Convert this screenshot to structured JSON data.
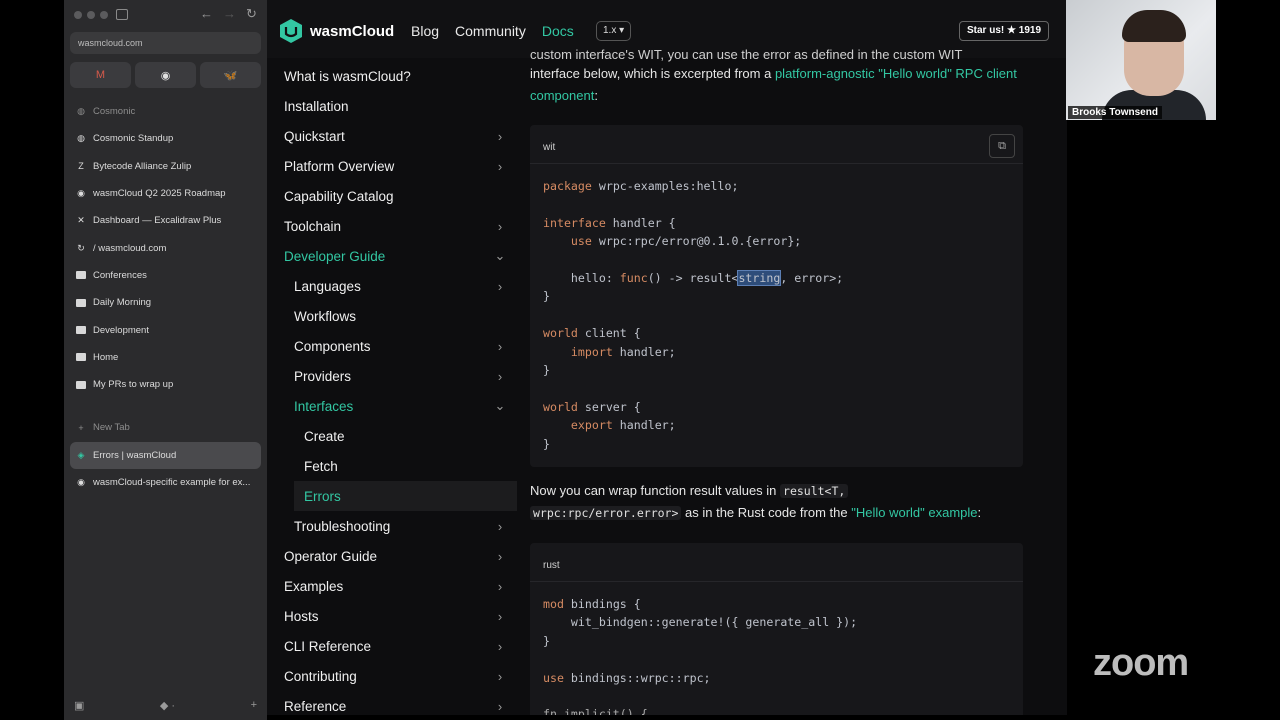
{
  "browser": {
    "url": "wasmcloud.com",
    "pinned": [
      {
        "icon": "gmail-icon",
        "glyph": "M",
        "color": "#d65a4b"
      },
      {
        "icon": "github-icon",
        "glyph": "◉",
        "color": "#e0e0e0"
      },
      {
        "icon": "bluesky-icon",
        "glyph": "🦋",
        "color": "#4a8bdc"
      }
    ],
    "bookmarks": [
      {
        "label": "Cosmonic",
        "icon": "cosmonic-icon",
        "glyph": "◍",
        "muted": true
      },
      {
        "label": "Cosmonic Standup",
        "icon": "cosmonic-icon",
        "glyph": "◍",
        "muted": false
      },
      {
        "label": "Bytecode Alliance Zulip",
        "icon": "zulip-icon",
        "glyph": "Z",
        "muted": false
      },
      {
        "label": "wasmCloud Q2 2025 Roadmap",
        "icon": "github-icon",
        "glyph": "◉",
        "muted": false
      },
      {
        "label": "Dashboard — Excalidraw Plus",
        "icon": "excalidraw-icon",
        "glyph": "✕",
        "muted": false
      },
      {
        "label": "/ wasmcloud.com",
        "icon": "refresh-icon",
        "glyph": "↻",
        "muted": false
      },
      {
        "label": "Conferences",
        "icon": "folder-icon",
        "glyph": "",
        "muted": false
      },
      {
        "label": "Daily Morning",
        "icon": "folder-icon",
        "glyph": "",
        "muted": false
      },
      {
        "label": "Development",
        "icon": "folder-icon",
        "glyph": "",
        "muted": false
      },
      {
        "label": "Home",
        "icon": "folder-icon",
        "glyph": "",
        "muted": false
      },
      {
        "label": "My PRs to wrap up",
        "icon": "folder-icon",
        "glyph": "",
        "muted": false
      }
    ],
    "new_tab": "New Tab",
    "tabs": [
      {
        "label": "Errors | wasmCloud",
        "active": true
      },
      {
        "label": "wasmCloud-specific example for ex...",
        "active": false
      }
    ]
  },
  "header": {
    "brand": "wasmCloud",
    "nav": [
      "Blog",
      "Community",
      "Docs"
    ],
    "version": "1.x ▾",
    "star": "Star us! ★ 1919"
  },
  "sidebar": {
    "items": [
      {
        "label": "What is wasmCloud?",
        "level": 0,
        "chevron": ""
      },
      {
        "label": "Installation",
        "level": 0,
        "chevron": ""
      },
      {
        "label": "Quickstart",
        "level": 0,
        "chevron": "›"
      },
      {
        "label": "Platform Overview",
        "level": 0,
        "chevron": "›"
      },
      {
        "label": "Capability Catalog",
        "level": 0,
        "chevron": ""
      },
      {
        "label": "Toolchain",
        "level": 0,
        "chevron": "›"
      },
      {
        "label": "Developer Guide",
        "level": 0,
        "chevron": "⌄",
        "green": true
      },
      {
        "label": "Languages",
        "level": 1,
        "chevron": "›"
      },
      {
        "label": "Workflows",
        "level": 1,
        "chevron": ""
      },
      {
        "label": "Components",
        "level": 1,
        "chevron": "›"
      },
      {
        "label": "Providers",
        "level": 1,
        "chevron": "›"
      },
      {
        "label": "Interfaces",
        "level": 1,
        "chevron": "⌄",
        "green": true
      },
      {
        "label": "Create",
        "level": 2,
        "chevron": ""
      },
      {
        "label": "Fetch",
        "level": 2,
        "chevron": ""
      },
      {
        "label": "Errors",
        "level": 2,
        "chevron": "",
        "green": true,
        "current": true
      },
      {
        "label": "Troubleshooting",
        "level": 1,
        "chevron": "›"
      },
      {
        "label": "Operator Guide",
        "level": 0,
        "chevron": "›"
      },
      {
        "label": "Examples",
        "level": 0,
        "chevron": "›"
      },
      {
        "label": "Hosts",
        "level": 0,
        "chevron": "›"
      },
      {
        "label": "CLI Reference",
        "level": 0,
        "chevron": "›"
      },
      {
        "label": "Contributing",
        "level": 0,
        "chevron": "›"
      },
      {
        "label": "Reference",
        "level": 0,
        "chevron": "›"
      }
    ]
  },
  "content": {
    "top_cut": "custom interface's WIT, you can use the error as defined in the custom WIT",
    "intro_a": "interface below, which is excerpted from a ",
    "intro_link": "platform-agnostic \"Hello world\" RPC client component",
    "intro_b": ":",
    "code1_lang": "wit",
    "mid_a": "Now you can wrap function result values in ",
    "mid_code1": "result<T,",
    "mid_code2": "wrpc:rpc/error.error>",
    "mid_b": " as in the Rust code from the ",
    "mid_link": "\"Hello world\" example",
    "mid_c": ":",
    "code2_lang": "rust"
  },
  "video": {
    "participant": "Brooks Townsend"
  },
  "zoom": "zoom",
  "colors": {
    "accent": "#33c7a3",
    "page_bg": "#0d0d0f",
    "code_bg": "#17171a"
  }
}
